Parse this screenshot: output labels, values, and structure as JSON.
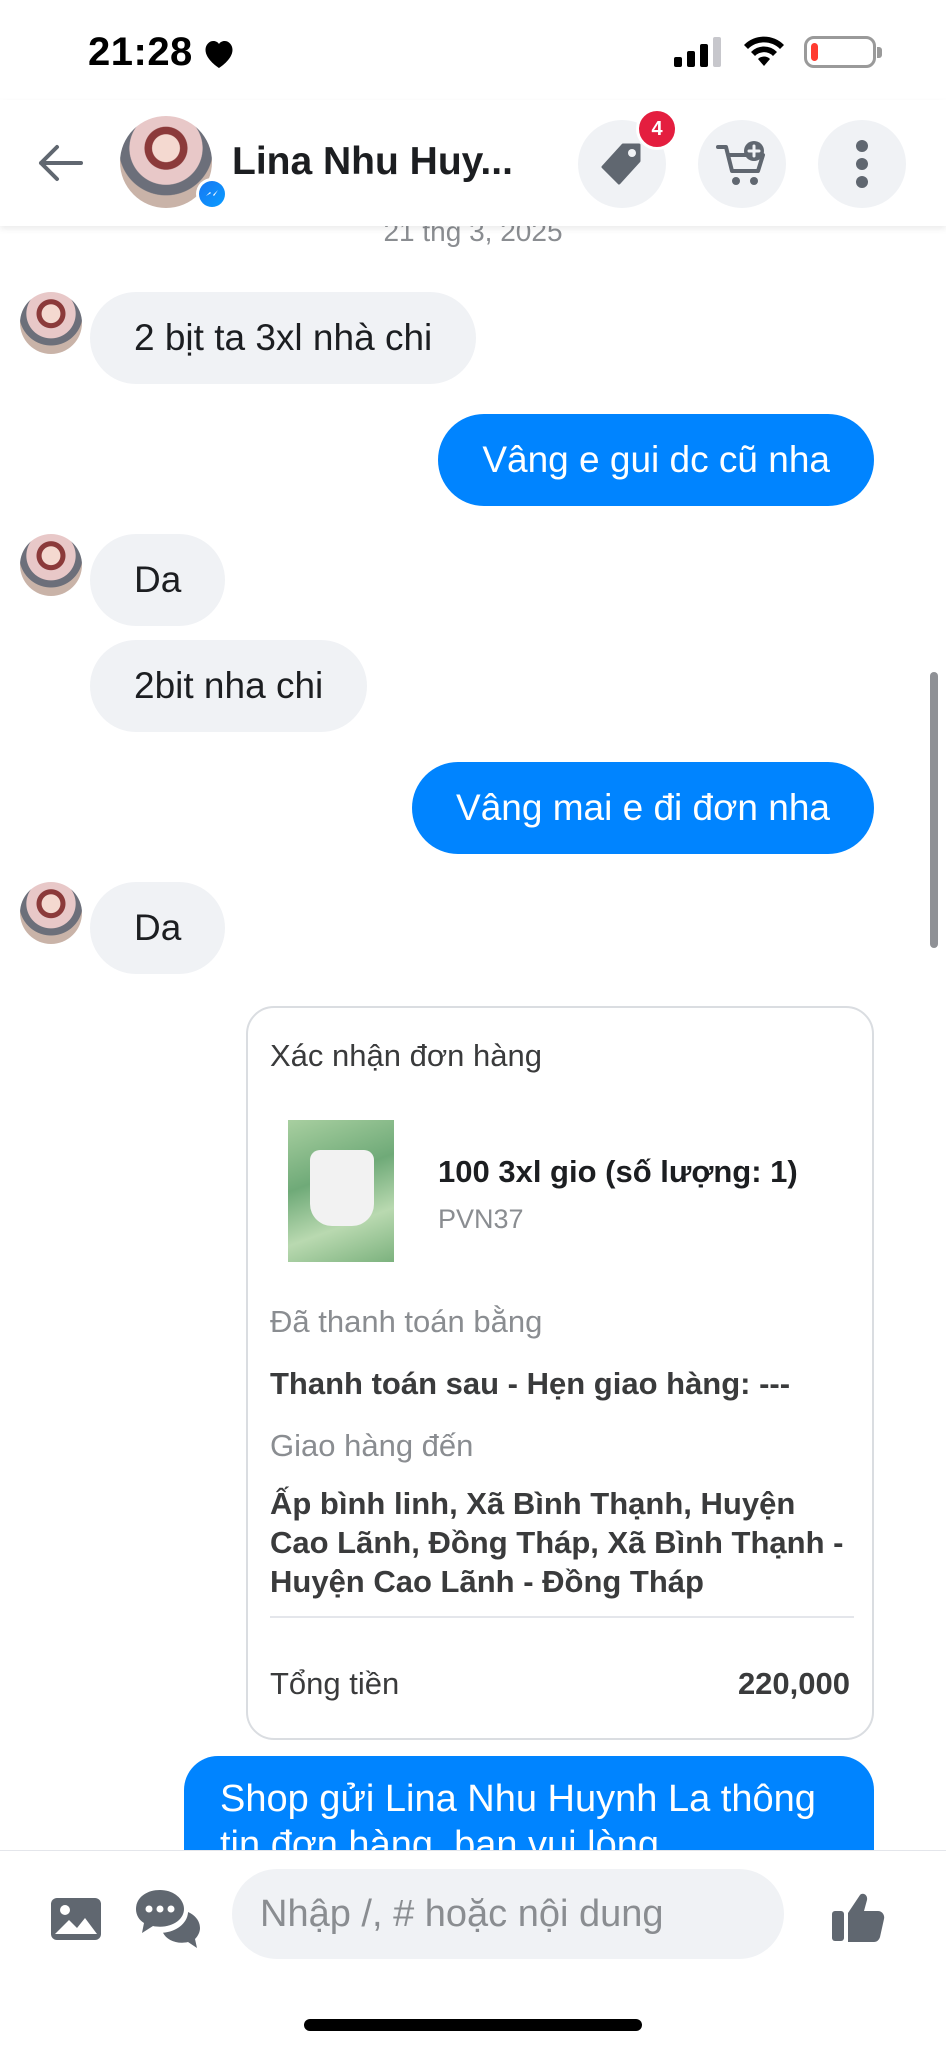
{
  "status_bar": {
    "time": "21:28",
    "battery_level": 0.12,
    "icons": [
      "heart-icon",
      "signal-icon",
      "wifi-icon",
      "battery-icon"
    ]
  },
  "header": {
    "contact_name": "Lina Nhu Huy...",
    "tag_badge_count": "4",
    "icons": [
      "back-arrow-icon",
      "messenger-icon",
      "tag-icon",
      "cart-plus-icon",
      "more-vertical-icon"
    ]
  },
  "chat": {
    "date_separator": "21 thg 3, 2025",
    "messages": [
      {
        "side": "in",
        "text": "2 bịt  ta 3xl nhà chi",
        "avatar": true
      },
      {
        "side": "out",
        "text": "Vâng e gui dc cũ nha"
      },
      {
        "side": "in",
        "text": "Da",
        "avatar": true
      },
      {
        "side": "in",
        "text": "2bit  nha chi",
        "avatar": false
      },
      {
        "side": "out",
        "text": "Vâng mai e đi đơn nha"
      },
      {
        "side": "in",
        "text": "Da",
        "avatar": true
      }
    ],
    "order_card": {
      "title": "Xác nhận đơn hàng",
      "item_name": "100 3xl gio (số lượng: 1)",
      "item_sku": "PVN37",
      "payment_label": "Đã thanh toán bằng",
      "payment_value": "Thanh toán sau - Hẹn giao hàng: ---",
      "shipping_label": "Giao hàng đến",
      "shipping_value": "Ấp bình linh, Xã Bình Thạnh, Huyện Cao Lãnh, Đồng Tháp, Xã Bình Thạnh - Huyện Cao Lãnh - Đồng Tháp",
      "total_label": "Tổng tiền",
      "total_value": "220,000"
    },
    "last_message": "Shop gửi Lina Nhu Huynh La thông tin đơn hàng, bạn vui lòng"
  },
  "composer": {
    "placeholder": "Nhập /, # hoặc nội dung",
    "icons": [
      "image-icon",
      "chat-bubbles-icon",
      "thumbs-up-icon"
    ]
  },
  "colors": {
    "accent": "#0084ff",
    "incoming_bubble": "#f0f2f5",
    "badge": "#e41e3f",
    "icon_gray": "#606770"
  }
}
